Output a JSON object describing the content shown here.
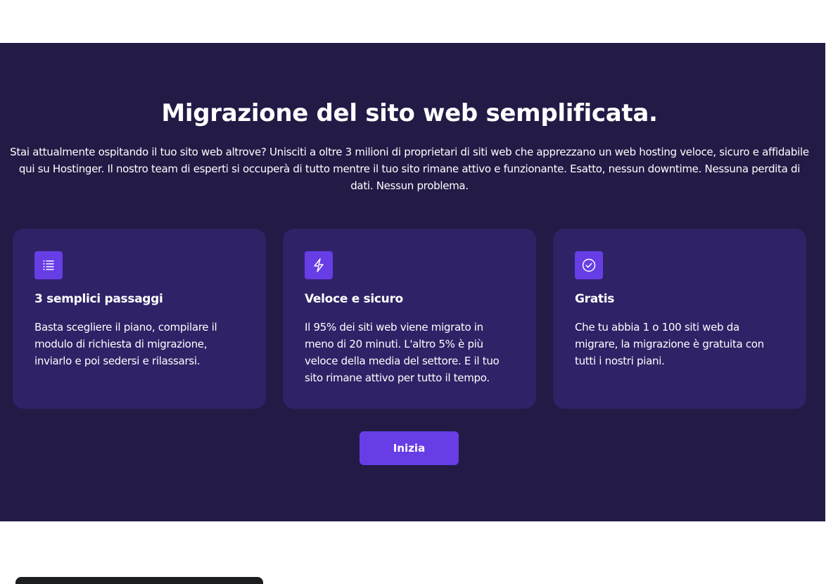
{
  "section": {
    "title": "Migrazione del sito web semplificata.",
    "lead": "Stai attualmente ospitando il tuo sito web altrove? Unisciti a oltre 3 milioni di proprietari di siti web che apprezzano un web hosting veloce, sicuro e affidabile qui su Hostinger. Il nostro team di esperti si occuperà di tutto mentre il tuo sito rimane attivo e funzionante. Esatto, nessun downtime. Nessuna perdita di dati. Nessun problema."
  },
  "cards": [
    {
      "icon": "list-icon",
      "title": "3 semplici passaggi",
      "text": "Basta scegliere il piano, compilare il modulo di richiesta di migrazione, inviarlo e poi sedersi e rilassarsi."
    },
    {
      "icon": "lightning-icon",
      "title": "Veloce e sicuro",
      "text": "Il 95% dei siti web viene migrato in meno di 20 minuti. L'altro 5% è più veloce della media del settore. E il tuo sito rimane attivo per tutto il tempo."
    },
    {
      "icon": "check-circle-icon",
      "title": "Gratis",
      "text": "Che tu abbia 1 o 100 siti web da migrare, la migrazione è gratuita con tutti i nostri piani."
    }
  ],
  "cta": {
    "label": "Inizia"
  },
  "colors": {
    "section_bg": "#231a46",
    "card_bg": "#2f2266",
    "accent": "#673de6",
    "text": "#ffffff"
  }
}
